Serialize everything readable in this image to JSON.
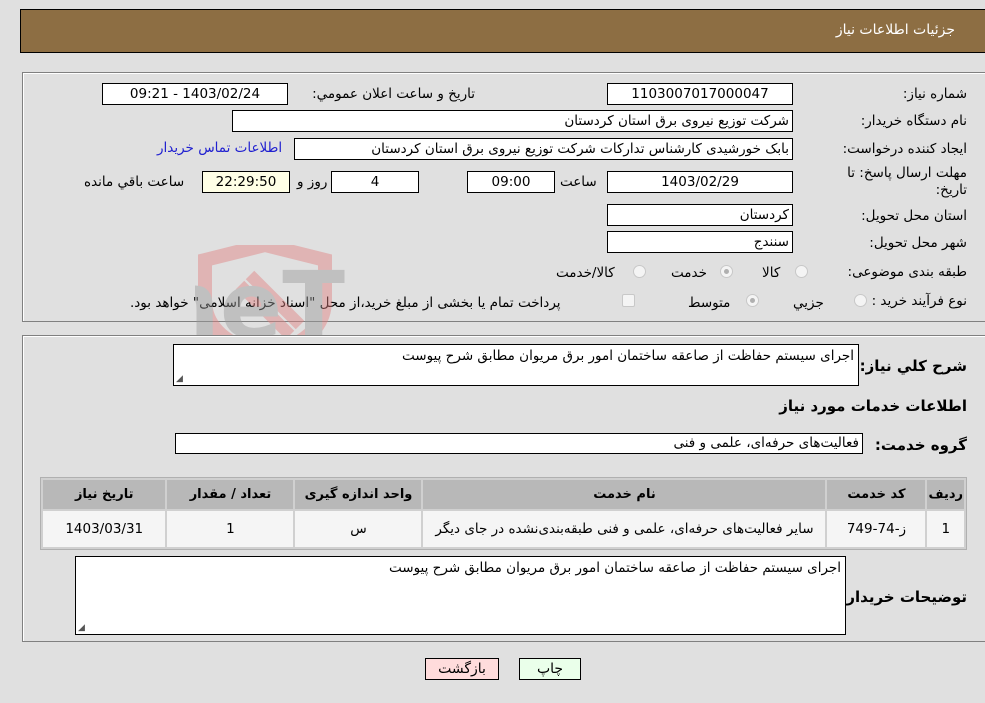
{
  "header": {
    "title": "جزئیات اطلاعات نیاز"
  },
  "details": {
    "need_number": {
      "label": "شماره نیاز:",
      "value": "1103007017000047"
    },
    "announce_datetime": {
      "label": "تاریخ و ساعت اعلان عمومي:",
      "value": "1403/02/24 - 09:21"
    },
    "buyer_org": {
      "label": "نام دستگاه خریدار:",
      "value": "شرکت توزیع نیروی برق استان کردستان"
    },
    "requester": {
      "label": "ایجاد کننده درخواست:",
      "value": "بابک خورشیدی کارشناس تدارکات شرکت توزیع نیروی برق استان کردستان"
    },
    "buyer_contact_link": "اطلاعات تماس خریدار",
    "deadline": {
      "label": "مهلت ارسال پاسخ: تا تاریخ:",
      "date": "1403/02/29",
      "time_label": "ساعت",
      "time": "09:00",
      "days": "4",
      "days_label": "روز و",
      "remaining": "22:29:50",
      "remaining_label": "ساعت باقي مانده"
    },
    "province": {
      "label": "استان محل تحویل:",
      "value": "کردستان"
    },
    "city": {
      "label": "شهر محل تحویل:",
      "value": "سنندج"
    },
    "category": {
      "label": "طبقه بندی موضوعی:",
      "options": [
        {
          "label": "کالا",
          "checked": false
        },
        {
          "label": "خدمت",
          "checked": true
        },
        {
          "label": "کالا/خدمت",
          "checked": false
        }
      ]
    },
    "purchase_type": {
      "label": "نوع فرآیند خرید :",
      "options": [
        {
          "label": "جزيي",
          "checked": false
        },
        {
          "label": "متوسط",
          "checked": true
        }
      ],
      "treasury_checkbox_label": "پرداخت تمام یا بخشی از مبلغ خرید،از محل \"اسناد خزانه اسلامی\" خواهد بود.",
      "treasury_checked": false
    }
  },
  "need": {
    "description_label": "شرح کلي نیاز:",
    "description": "اجرای سیستم حفاظت از صاعقه ساختمان امور برق مریوان مطابق شرح پیوست",
    "services_heading": "اطلاعات خدمات مورد نیاز",
    "service_group_label": "گروه خدمت:",
    "service_group": "فعالیت‌های حرفه‌ای، علمی و فنی"
  },
  "table": {
    "headers": [
      "ردیف",
      "کد خدمت",
      "نام خدمت",
      "واحد اندازه گیری",
      "تعداد / مقدار",
      "تاریخ نیاز"
    ],
    "rows": [
      [
        "1",
        "ز-74-749",
        "سایر فعالیت‌های حرفه‌ای، علمی و فنی طبقه‌بندی‌نشده در جای دیگر",
        "س",
        "1",
        "1403/03/31"
      ]
    ]
  },
  "buyer_notes": {
    "label": "توضیحات خریدار:",
    "value": "اجرای سیستم حفاظت از صاعقه ساختمان امور برق مریوان مطابق شرح پیوست"
  },
  "buttons": {
    "print": "چاپ",
    "back": "بازگشت"
  },
  "watermark": "AriaTender.neT"
}
